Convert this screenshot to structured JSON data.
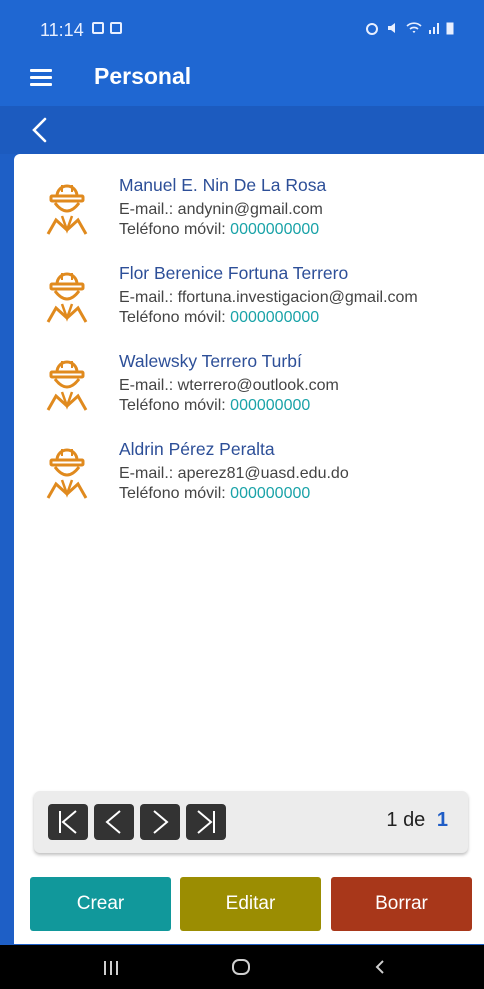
{
  "status_bar": {
    "time": "11:14"
  },
  "app_bar": {
    "title": "Personal"
  },
  "people": [
    {
      "name": "Manuel E. Nin De La Rosa",
      "email_label": "E-mail.: ",
      "email": "andynin@gmail.com",
      "phone_label": "Teléfono móvil: ",
      "phone": "0000000000"
    },
    {
      "name": "Flor Berenice Fortuna Terrero",
      "email_label": "E-mail.: ",
      "email": "ffortuna.investigacion@gmail.com",
      "phone_label": "Teléfono móvil: ",
      "phone": "0000000000"
    },
    {
      "name": "Walewsky Terrero Turbí",
      "email_label": "E-mail.: ",
      "email": "wterrero@outlook.com",
      "phone_label": "Teléfono móvil: ",
      "phone": "000000000"
    },
    {
      "name": "Aldrin Pérez Peralta",
      "email_label": "E-mail.: ",
      "email": "aperez81@uasd.edu.do",
      "phone_label": "Teléfono móvil: ",
      "phone": "000000000"
    }
  ],
  "pager": {
    "current": "1",
    "separator": "de",
    "total": "1",
    "icons": [
      "first-page-icon",
      "previous-page-icon",
      "next-page-icon",
      "last-page-icon"
    ]
  },
  "actions": {
    "create": "Crear",
    "edit": "Editar",
    "delete": "Borrar"
  },
  "colors": {
    "primary": "#1f67d2",
    "create": "#11989b",
    "edit": "#9b8d02",
    "delete": "#a8371a",
    "avatar": "#e08a1e",
    "name": "#2d4f98",
    "phone": "#1aa3a8"
  }
}
